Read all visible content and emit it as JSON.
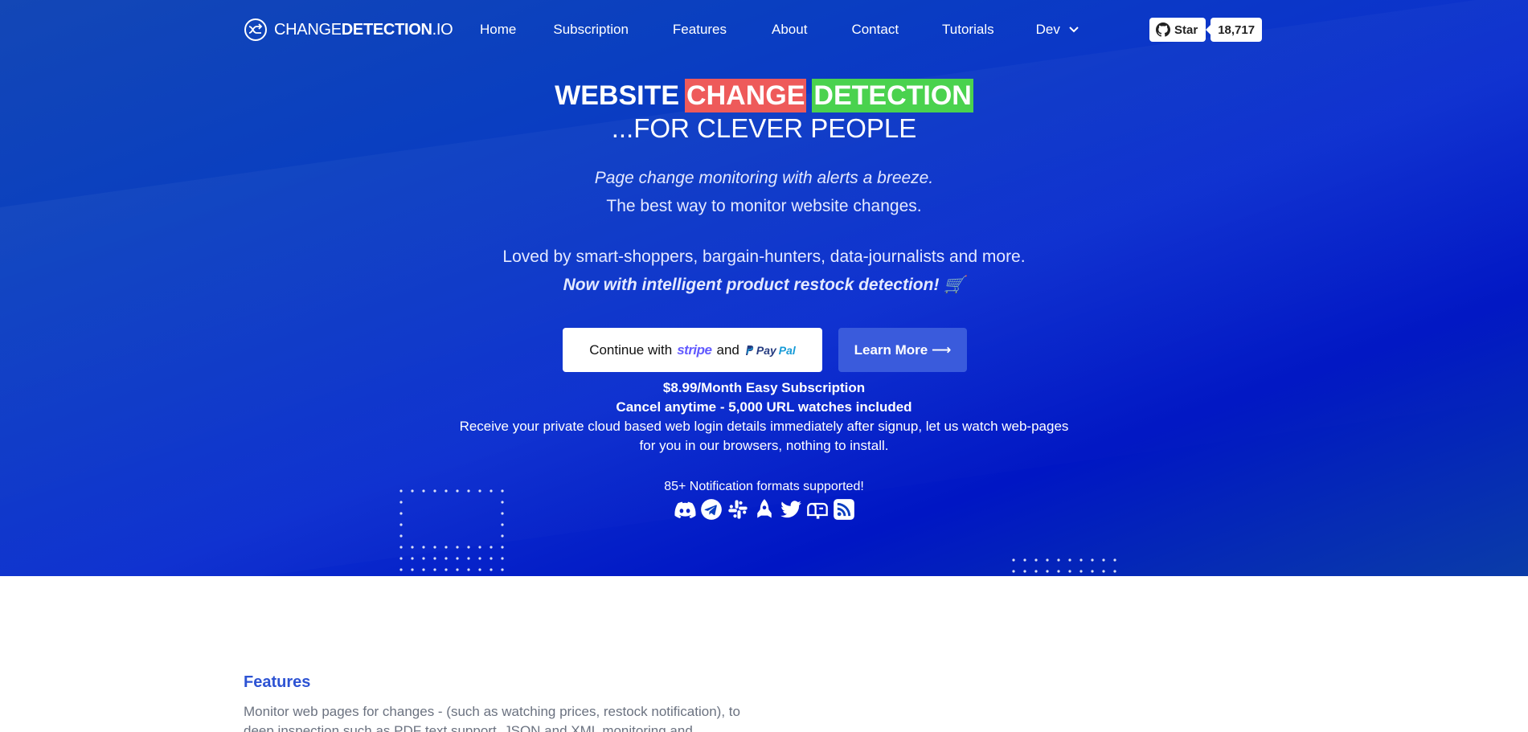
{
  "logo": {
    "text_regular": "CHANGE",
    "text_bold": "DETECTION",
    "text_suffix": ".IO"
  },
  "nav": {
    "items": [
      {
        "label": "Home"
      },
      {
        "label": "Subscription"
      },
      {
        "label": "Features"
      },
      {
        "label": "About"
      },
      {
        "label": "Contact"
      },
      {
        "label": "Tutorials"
      },
      {
        "label": "Dev"
      }
    ]
  },
  "github": {
    "star_label": "Star",
    "count": "18,717"
  },
  "hero": {
    "title_word1": "WEBSITE",
    "title_word2": "CHANGE",
    "title_word3": "DETECTION",
    "title_line2": "...FOR CLEVER PEOPLE",
    "tagline_italic": "Page change monitoring with alerts a breeze.",
    "tagline": "The best way to monitor website changes.",
    "loved": "Loved by smart-shoppers, bargain-hunters, data-journalists and more.",
    "restock": "Now with intelligent product restock detection! 🛒"
  },
  "cta": {
    "pay_prefix": "Continue with",
    "stripe": "stripe",
    "pay_and": "and",
    "paypal_1": "Pay",
    "paypal_2": "Pal",
    "learn_more": "Learn More ⟶"
  },
  "pricing": {
    "line1": "$8.99/Month Easy Subscription",
    "line2": "Cancel anytime - 5,000 URL watches included",
    "line3": "Receive your private cloud based web login details immediately after signup, let us watch web-pages",
    "line4": "for you in our browsers, nothing to install."
  },
  "notifications": {
    "label": "85+ Notification formats supported!",
    "icons": [
      "discord-icon",
      "telegram-icon",
      "slack-icon",
      "rocket-icon",
      "twitter-icon",
      "mailbox-icon",
      "rss-icon"
    ]
  },
  "features": {
    "title": "Features",
    "text": "Monitor web pages for changes - (such as watching prices, restock notification), to deep inspection such as PDF text support, JSON and XML monitoring and"
  },
  "colors": {
    "accent": "#2d53d3",
    "red_highlight": "#ee5a5a",
    "green_highlight": "#4ad24e",
    "hero_bg": "#0a3fc0"
  }
}
